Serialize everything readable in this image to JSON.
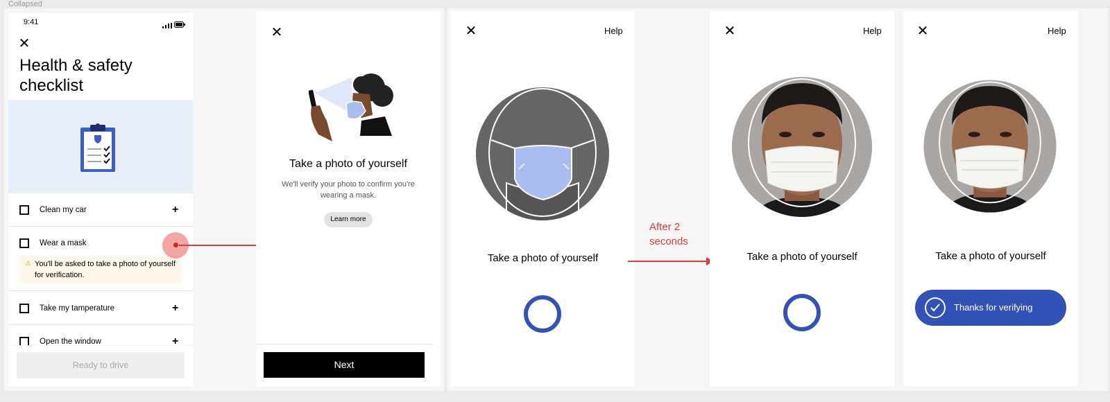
{
  "top_label": "Collapsed",
  "screen1": {
    "time": "9:41",
    "title_line1": "Health & safety",
    "title_line2": "checklist",
    "items": [
      {
        "label": "Clean my car"
      },
      {
        "label": "Wear a mask"
      },
      {
        "label": "Take my tamperature"
      },
      {
        "label": "Open the window"
      }
    ],
    "warning": "You'll be asked to take a photo of yourself for verification.",
    "ready_button": "Ready to drive"
  },
  "screen2": {
    "heading": "Take a photo of yourself",
    "subtitle": "We'll verify your photo to confirm you're wearing a mask.",
    "learn_more": "Learn more",
    "next_button": "Next"
  },
  "screen3": {
    "help": "Help",
    "heading": "Take a photo of yourself"
  },
  "annotation": {
    "text": "After 2 seconds"
  },
  "screen4": {
    "help": "Help",
    "heading": "Take a photo of yourself"
  },
  "screen5": {
    "help": "Help",
    "heading": "Take a photo of yourself",
    "verified_label": "Thanks for verifying"
  },
  "colors": {
    "accent": "#3352b8",
    "annotation": "#e53935",
    "hero_bg": "#e9eefb"
  }
}
